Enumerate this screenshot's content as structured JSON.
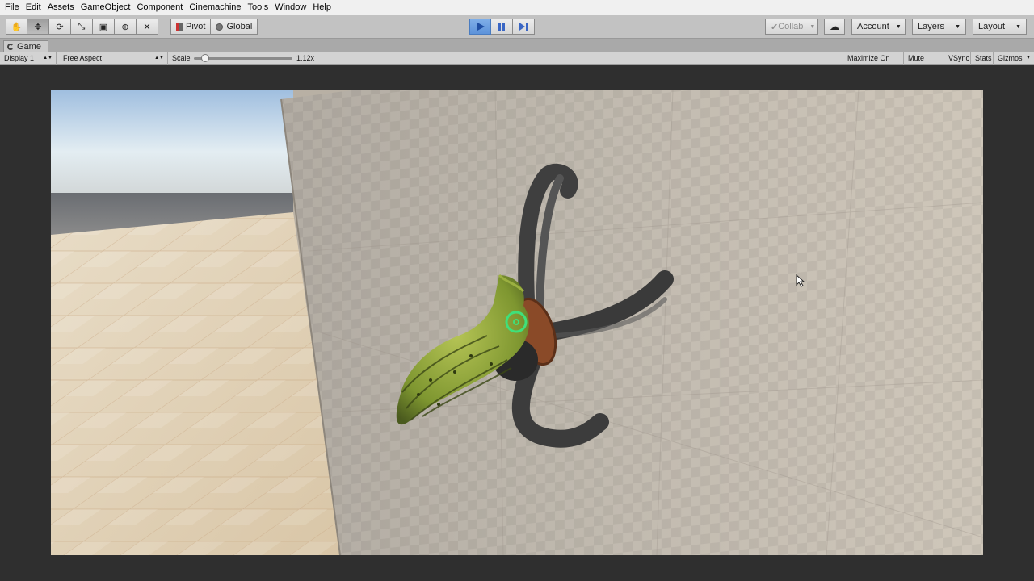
{
  "menu": [
    "File",
    "Edit",
    "Assets",
    "GameObject",
    "Component",
    "Cinemachine",
    "Tools",
    "Window",
    "Help"
  ],
  "toolbar": {
    "tools": [
      {
        "icon": "hand-tool-icon",
        "glyph": "✋"
      },
      {
        "icon": "move-tool-icon",
        "glyph": "✥"
      },
      {
        "icon": "rotate-tool-icon",
        "glyph": "⟳"
      },
      {
        "icon": "scale-tool-icon",
        "glyph": "⤡"
      },
      {
        "icon": "rect-tool-icon",
        "glyph": "▣"
      },
      {
        "icon": "transform-tool-icon",
        "glyph": "⊕"
      },
      {
        "icon": "custom-tool-icon",
        "glyph": "✕"
      }
    ],
    "pivot_label": "Pivot",
    "global_label": "Global",
    "collab_label": "Collab",
    "account_label": "Account",
    "layers_label": "Layers",
    "layout_label": "Layout",
    "play_active": true,
    "accent": "#5d93da"
  },
  "game_tab": {
    "label": "Game"
  },
  "controls": {
    "display": "Display 1",
    "aspect": "Free Aspect",
    "scale_label": "Scale",
    "scale_value": "1.12x",
    "scale_fraction": 0.08,
    "maximize": "Maximize On Play",
    "mute": "Mute Audio",
    "vsync": "VSync",
    "stats": "Stats",
    "gizmos": "Gizmos"
  },
  "scene": {
    "crosshair_color": "#3fe07a",
    "cursor_icon": "mouse-cursor-icon"
  }
}
